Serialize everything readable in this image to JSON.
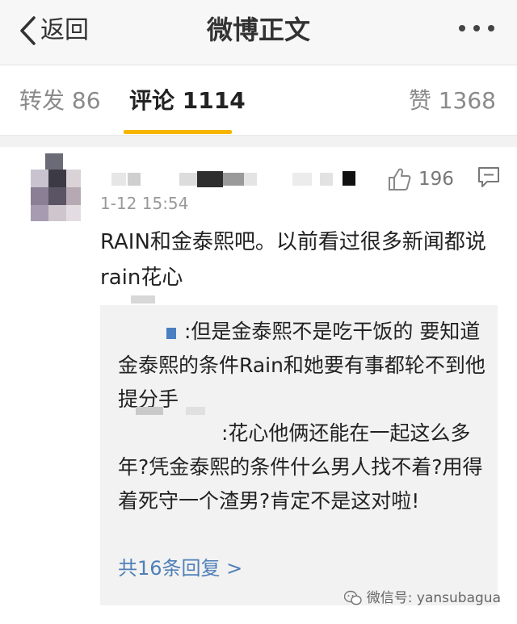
{
  "nav": {
    "back_label": "返回",
    "title": "微博正文"
  },
  "tabs": {
    "repost": "转发 86",
    "comments": "评论 1114",
    "likes": "赞 1368",
    "active_color": "#f7b500"
  },
  "comment": {
    "time": "1-12 15:54",
    "likes": "196",
    "text": "RAIN和金泰熙吧。以前看过很多新闻都说rain花心",
    "replies": [
      {
        "text": ":但是金泰熙不是吃干饭的 要知道金泰熙的条件Rain和她要有事都轮不到他提分手"
      },
      {
        "text": ":花心他俩还能在一起这么多年?凭金泰熙的条件什么男人找不着?用得着死守一个渣男?肯定不是这对啦!"
      }
    ],
    "more_replies": "共16条回复 >",
    "link_color": "#4f7fb8"
  },
  "watermark": {
    "text": "微信号: yansubagua",
    "icon": "wechat-icon"
  }
}
